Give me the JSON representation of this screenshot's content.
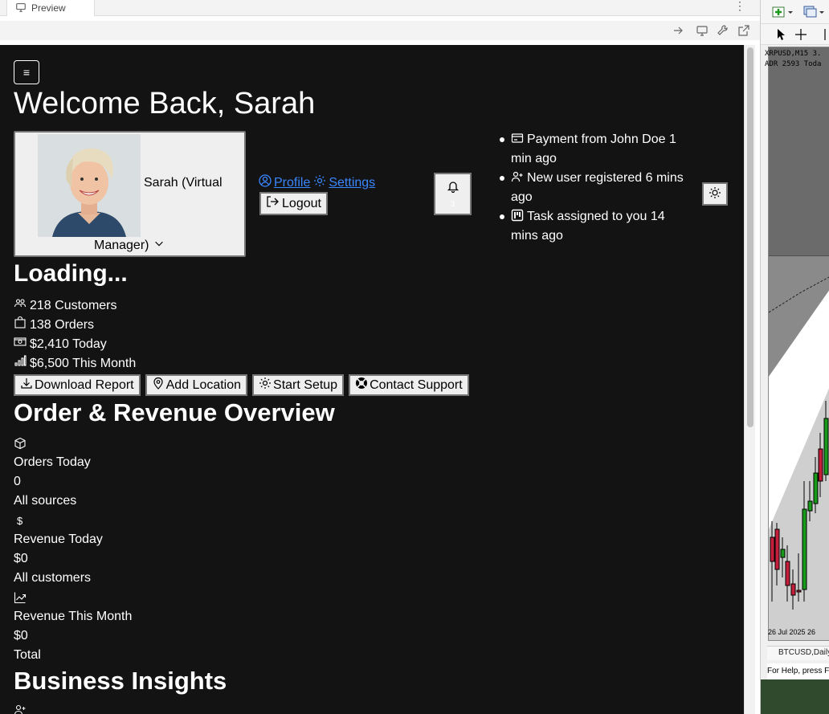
{
  "browser": {
    "tab_label": "Preview",
    "more_label": "⋮"
  },
  "app": {
    "menu_label": "≡",
    "title": "Welcome Back, Sarah",
    "profile": {
      "name_line1": "Sarah (Virtual",
      "name_line2": "Manager)",
      "profile_link": "Profile",
      "settings_link": "Settings",
      "logout_label": "Logout"
    },
    "notifications": {
      "count": "3",
      "items": [
        {
          "icon": "payment-card-icon",
          "text": "Payment from John Doe 1 min ago"
        },
        {
          "icon": "user-plus-icon",
          "text": "New user registered 6 mins ago"
        },
        {
          "icon": "kanban-icon",
          "text": "Task assigned to you 14 mins ago"
        }
      ]
    },
    "loading_label": "Loading...",
    "stats": [
      {
        "icon": "people-icon",
        "text": "218 Customers"
      },
      {
        "icon": "bag-icon",
        "text": "138 Orders"
      },
      {
        "icon": "cash-icon",
        "text": "$2,410 Today"
      },
      {
        "icon": "bar-chart-icon",
        "text": "$6,500 This Month"
      }
    ],
    "actions": [
      {
        "icon": "download-icon",
        "label": "Download Report"
      },
      {
        "icon": "location-pin-icon",
        "label": "Add Location"
      },
      {
        "icon": "gear-icon",
        "label": "Start Setup"
      },
      {
        "icon": "lifebuoy-icon",
        "label": "Contact Support"
      }
    ],
    "overview": {
      "title": "Order & Revenue Overview",
      "cards": [
        {
          "icon": "box-icon",
          "label": "Orders Today",
          "value": "0",
          "note": "All sources"
        },
        {
          "icon": "dollar-icon",
          "label": "Revenue Today",
          "value": "$0",
          "note": "All customers"
        },
        {
          "icon": "graph-up-icon",
          "label": "Revenue This Month",
          "value": "$0",
          "note": "Total"
        }
      ]
    },
    "insights_title": "Business Insights"
  },
  "trader": {
    "symbol_header": "XRPUSD,M15  3.",
    "adr_header": "ADR 2593  Toda",
    "date_label": "26 Jul 2025     26",
    "sheet_tab": "BTCUSD,Daily",
    "status": "For Help, press F"
  },
  "colors": {
    "app_bg": "#131313",
    "link": "#3a87ff",
    "button_bg": "#efefef"
  }
}
